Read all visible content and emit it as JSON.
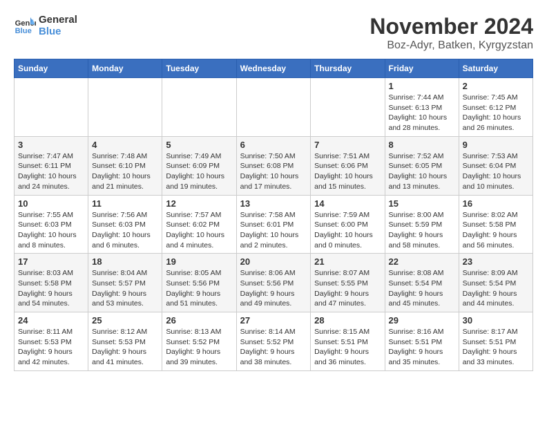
{
  "logo": {
    "text_general": "General",
    "text_blue": "Blue"
  },
  "title": "November 2024",
  "location": "Boz-Adyr, Batken, Kyrgyzstan",
  "days_of_week": [
    "Sunday",
    "Monday",
    "Tuesday",
    "Wednesday",
    "Thursday",
    "Friday",
    "Saturday"
  ],
  "weeks": [
    [
      {
        "day": "",
        "info": ""
      },
      {
        "day": "",
        "info": ""
      },
      {
        "day": "",
        "info": ""
      },
      {
        "day": "",
        "info": ""
      },
      {
        "day": "",
        "info": ""
      },
      {
        "day": "1",
        "info": "Sunrise: 7:44 AM\nSunset: 6:13 PM\nDaylight: 10 hours and 28 minutes."
      },
      {
        "day": "2",
        "info": "Sunrise: 7:45 AM\nSunset: 6:12 PM\nDaylight: 10 hours and 26 minutes."
      }
    ],
    [
      {
        "day": "3",
        "info": "Sunrise: 7:47 AM\nSunset: 6:11 PM\nDaylight: 10 hours and 24 minutes."
      },
      {
        "day": "4",
        "info": "Sunrise: 7:48 AM\nSunset: 6:10 PM\nDaylight: 10 hours and 21 minutes."
      },
      {
        "day": "5",
        "info": "Sunrise: 7:49 AM\nSunset: 6:09 PM\nDaylight: 10 hours and 19 minutes."
      },
      {
        "day": "6",
        "info": "Sunrise: 7:50 AM\nSunset: 6:08 PM\nDaylight: 10 hours and 17 minutes."
      },
      {
        "day": "7",
        "info": "Sunrise: 7:51 AM\nSunset: 6:06 PM\nDaylight: 10 hours and 15 minutes."
      },
      {
        "day": "8",
        "info": "Sunrise: 7:52 AM\nSunset: 6:05 PM\nDaylight: 10 hours and 13 minutes."
      },
      {
        "day": "9",
        "info": "Sunrise: 7:53 AM\nSunset: 6:04 PM\nDaylight: 10 hours and 10 minutes."
      }
    ],
    [
      {
        "day": "10",
        "info": "Sunrise: 7:55 AM\nSunset: 6:03 PM\nDaylight: 10 hours and 8 minutes."
      },
      {
        "day": "11",
        "info": "Sunrise: 7:56 AM\nSunset: 6:03 PM\nDaylight: 10 hours and 6 minutes."
      },
      {
        "day": "12",
        "info": "Sunrise: 7:57 AM\nSunset: 6:02 PM\nDaylight: 10 hours and 4 minutes."
      },
      {
        "day": "13",
        "info": "Sunrise: 7:58 AM\nSunset: 6:01 PM\nDaylight: 10 hours and 2 minutes."
      },
      {
        "day": "14",
        "info": "Sunrise: 7:59 AM\nSunset: 6:00 PM\nDaylight: 10 hours and 0 minutes."
      },
      {
        "day": "15",
        "info": "Sunrise: 8:00 AM\nSunset: 5:59 PM\nDaylight: 9 hours and 58 minutes."
      },
      {
        "day": "16",
        "info": "Sunrise: 8:02 AM\nSunset: 5:58 PM\nDaylight: 9 hours and 56 minutes."
      }
    ],
    [
      {
        "day": "17",
        "info": "Sunrise: 8:03 AM\nSunset: 5:58 PM\nDaylight: 9 hours and 54 minutes."
      },
      {
        "day": "18",
        "info": "Sunrise: 8:04 AM\nSunset: 5:57 PM\nDaylight: 9 hours and 53 minutes."
      },
      {
        "day": "19",
        "info": "Sunrise: 8:05 AM\nSunset: 5:56 PM\nDaylight: 9 hours and 51 minutes."
      },
      {
        "day": "20",
        "info": "Sunrise: 8:06 AM\nSunset: 5:56 PM\nDaylight: 9 hours and 49 minutes."
      },
      {
        "day": "21",
        "info": "Sunrise: 8:07 AM\nSunset: 5:55 PM\nDaylight: 9 hours and 47 minutes."
      },
      {
        "day": "22",
        "info": "Sunrise: 8:08 AM\nSunset: 5:54 PM\nDaylight: 9 hours and 45 minutes."
      },
      {
        "day": "23",
        "info": "Sunrise: 8:09 AM\nSunset: 5:54 PM\nDaylight: 9 hours and 44 minutes."
      }
    ],
    [
      {
        "day": "24",
        "info": "Sunrise: 8:11 AM\nSunset: 5:53 PM\nDaylight: 9 hours and 42 minutes."
      },
      {
        "day": "25",
        "info": "Sunrise: 8:12 AM\nSunset: 5:53 PM\nDaylight: 9 hours and 41 minutes."
      },
      {
        "day": "26",
        "info": "Sunrise: 8:13 AM\nSunset: 5:52 PM\nDaylight: 9 hours and 39 minutes."
      },
      {
        "day": "27",
        "info": "Sunrise: 8:14 AM\nSunset: 5:52 PM\nDaylight: 9 hours and 38 minutes."
      },
      {
        "day": "28",
        "info": "Sunrise: 8:15 AM\nSunset: 5:51 PM\nDaylight: 9 hours and 36 minutes."
      },
      {
        "day": "29",
        "info": "Sunrise: 8:16 AM\nSunset: 5:51 PM\nDaylight: 9 hours and 35 minutes."
      },
      {
        "day": "30",
        "info": "Sunrise: 8:17 AM\nSunset: 5:51 PM\nDaylight: 9 hours and 33 minutes."
      }
    ]
  ]
}
